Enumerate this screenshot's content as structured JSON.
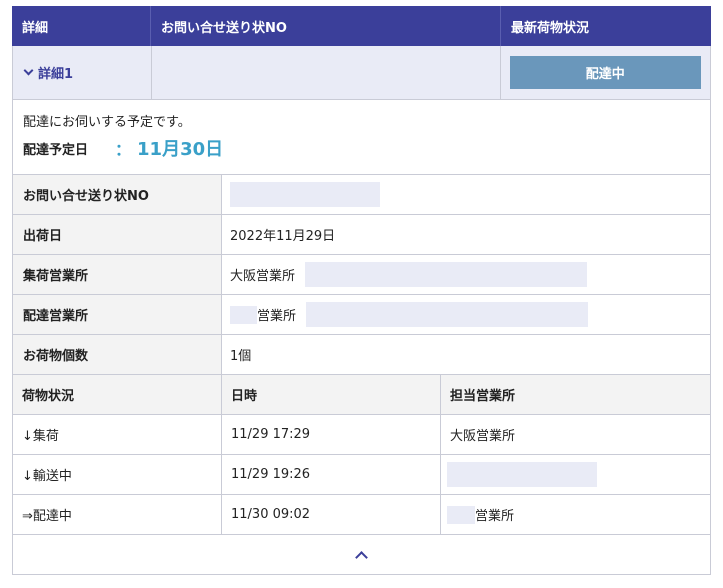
{
  "header": {
    "col_detail": "詳細",
    "col_tracking_no": "お問い合せ送り状NO",
    "col_status": "最新荷物状況"
  },
  "summary": {
    "detail_toggle": "詳細1",
    "status_button": "配達中"
  },
  "notice": {
    "message": "配達にお伺いする予定です。",
    "scheduled_label": "配達予定日",
    "colon": "：",
    "scheduled_date": "11月30日"
  },
  "details": {
    "tracking_label": "お問い合せ送り状NO",
    "ship_date_label": "出荷日",
    "ship_date_value": "2022年11月29日",
    "pickup_office_label": "集荷営業所",
    "pickup_office_value": "大阪営業所",
    "delivery_office_label": "配達営業所",
    "delivery_office_value": "営業所",
    "package_count_label": "お荷物個数",
    "package_count_value": "1個"
  },
  "history": {
    "headers": [
      "荷物状況",
      "日時",
      "担当営業所"
    ],
    "rows": [
      {
        "status": "↓集荷",
        "datetime": "11/29 17:29",
        "office": "大阪営業所"
      },
      {
        "status": "↓輸送中",
        "datetime": "11/29 19:26",
        "office": ""
      },
      {
        "status": "⇒配達中",
        "datetime": "11/30 09:02",
        "office": "営業所"
      }
    ]
  },
  "footer": {
    "collapse_icon": "chevron-up-icon"
  },
  "colors": {
    "header_bg": "#3b3f9a",
    "status_button_bg": "#6a97bb",
    "date_accent": "#3aa0c8",
    "summary_bg": "#e9ebf6"
  }
}
